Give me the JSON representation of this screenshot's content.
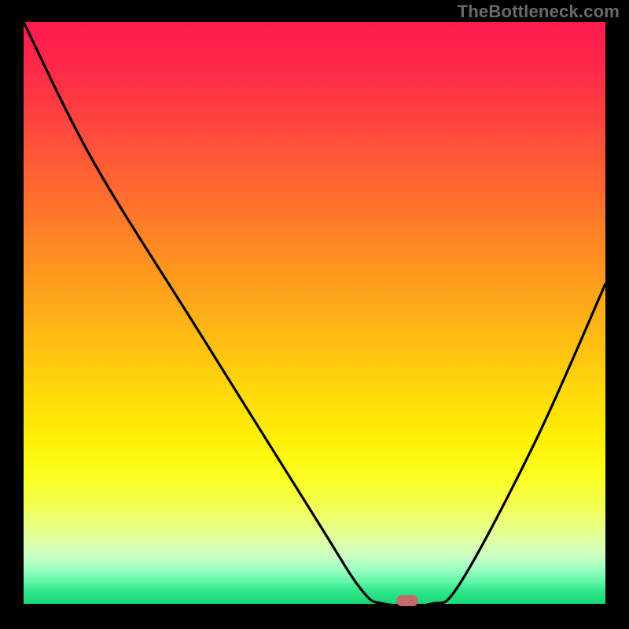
{
  "watermark": "TheBottleneck.com",
  "chart_data": {
    "type": "line",
    "title": "",
    "xlabel": "",
    "ylabel": "",
    "xrange": [
      0,
      100
    ],
    "yrange": [
      0,
      100
    ],
    "series": [
      {
        "name": "bottleneck-curve",
        "points": [
          {
            "x": 0,
            "y": 100
          },
          {
            "x": 12,
            "y": 76
          },
          {
            "x": 30,
            "y": 47
          },
          {
            "x": 50,
            "y": 15
          },
          {
            "x": 58,
            "y": 2.5
          },
          {
            "x": 62,
            "y": 0
          },
          {
            "x": 70,
            "y": 0
          },
          {
            "x": 75,
            "y": 3.5
          },
          {
            "x": 88,
            "y": 28
          },
          {
            "x": 100,
            "y": 55
          }
        ]
      }
    ],
    "background": {
      "type": "vertical-gradient",
      "stops": [
        {
          "pct": 0,
          "color": "#ff1a4d"
        },
        {
          "pct": 50,
          "color": "#ffb814"
        },
        {
          "pct": 80,
          "color": "#f5ff40"
        },
        {
          "pct": 100,
          "color": "#18d877"
        }
      ]
    },
    "marker": {
      "x": 66,
      "y": 0.6,
      "color": "#c16b6b"
    }
  }
}
